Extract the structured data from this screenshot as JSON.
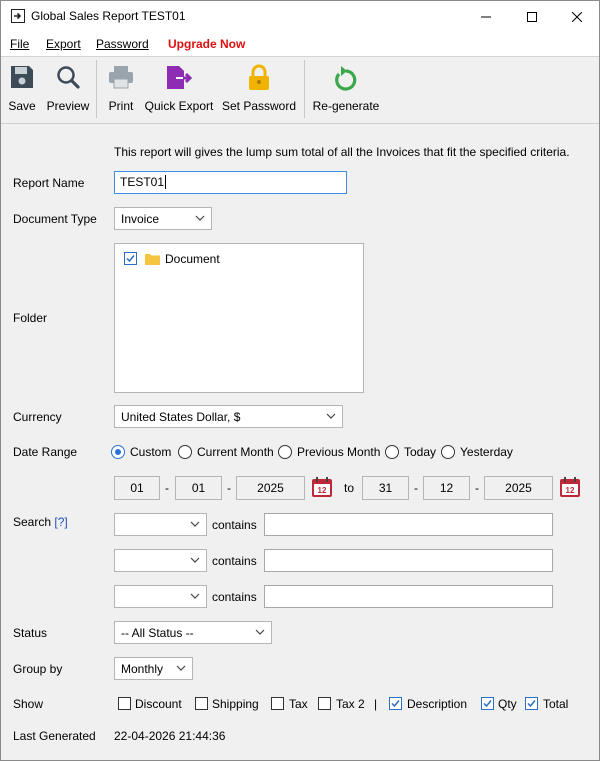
{
  "window": {
    "title": "Global Sales Report TEST01"
  },
  "menu": {
    "file": "File",
    "export": "Export",
    "password": "Password",
    "upgrade": "Upgrade Now"
  },
  "toolbar": {
    "save": "Save",
    "preview": "Preview",
    "print": "Print",
    "quick_export": "Quick Export",
    "set_password": "Set Password",
    "regenerate": "Re-generate"
  },
  "form": {
    "info_text": "This report will gives the lump sum total of all the Invoices that fit the specified criteria.",
    "report_name_label": "Report Name",
    "report_name_value": "TEST01",
    "document_type_label": "Document Type",
    "document_type_value": "Invoice",
    "folder_label": "Folder",
    "folder_item": "Document",
    "currency_label": "Currency",
    "currency_value": "United States Dollar, $",
    "date_range_label": "Date Range",
    "date_options": [
      "Custom",
      "Current Month",
      "Previous Month",
      "Today",
      "Yesterday"
    ],
    "date_selected": "Custom",
    "from_day": "01",
    "from_month": "01",
    "from_year": "2025",
    "to_text": "to",
    "to_day": "31",
    "to_month": "12",
    "to_year": "2025",
    "dash": "-",
    "calendar_icon_text": "12",
    "search_label": "Search",
    "search_help": "[?]",
    "contains_text": "contains",
    "status_label": "Status",
    "status_value": "-- All Status --",
    "group_by_label": "Group by",
    "group_by_value": "Monthly",
    "show_label": "Show",
    "show_options": [
      {
        "label": "Discount",
        "checked": false
      },
      {
        "label": "Shipping",
        "checked": false
      },
      {
        "label": "Tax",
        "checked": false
      },
      {
        "label": "Tax 2",
        "checked": false
      },
      {
        "label": "Description",
        "checked": true
      },
      {
        "label": "Qty",
        "checked": true
      },
      {
        "label": "Total",
        "checked": true
      }
    ],
    "show_separator": "|",
    "last_generated_label": "Last Generated",
    "last_generated_value": "22-04-2026 21:44:36"
  },
  "colors": {
    "upgrade": "#e01010",
    "accent": "#2a73d8",
    "save_icon": "#3d4a57",
    "quick_export_icon": "#8e2cb3",
    "lock_icon": "#f0b400",
    "regenerate_icon": "#3aa84a",
    "calendar_icon": "#c0283a"
  }
}
